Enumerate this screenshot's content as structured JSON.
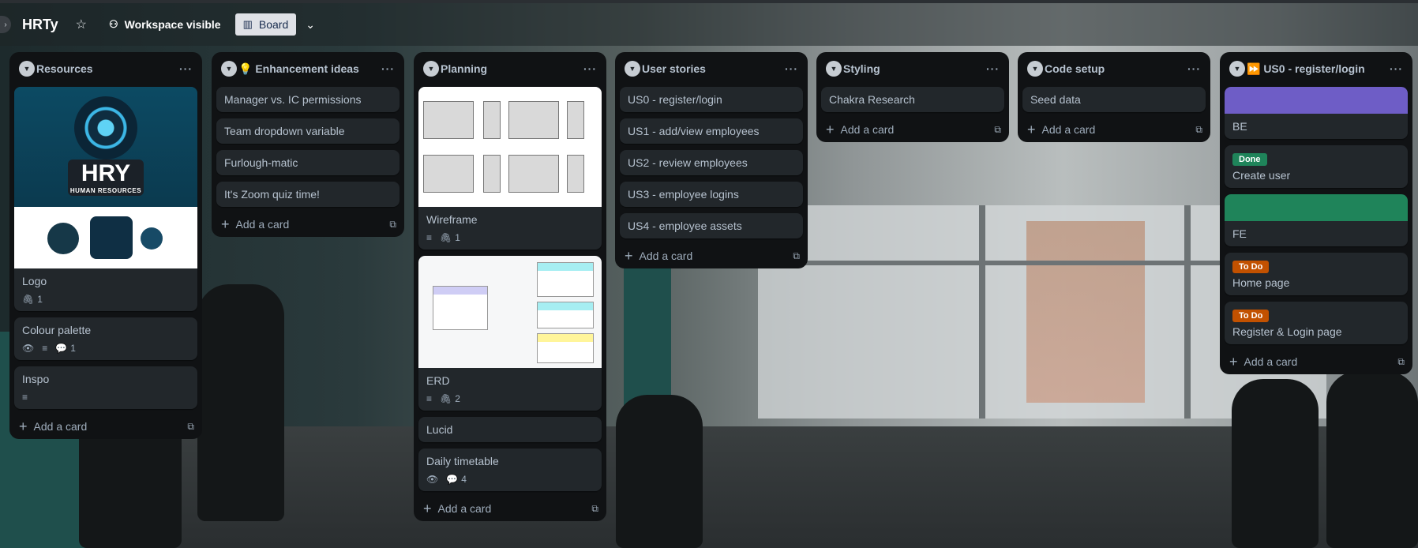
{
  "board": {
    "title": "HRTy",
    "visibility": "Workspace visible",
    "view": "Board"
  },
  "lists": [
    {
      "title": "Resources",
      "cards": [
        {
          "title": "Logo",
          "attachments": "1"
        },
        {
          "title": "Colour palette",
          "comments": "1"
        },
        {
          "title": "Inspo"
        }
      ],
      "add": "Add a card"
    },
    {
      "title": "💡 Enhancement ideas",
      "cards": [
        {
          "title": "Manager vs. IC permissions"
        },
        {
          "title": "Team dropdown variable"
        },
        {
          "title": "Furlough-matic"
        },
        {
          "title": "It's Zoom quiz time!"
        }
      ],
      "add": "Add a card"
    },
    {
      "title": "Planning",
      "cards": [
        {
          "title": "Wireframe",
          "attachments": "1"
        },
        {
          "title": "ERD",
          "attachments": "2"
        },
        {
          "title": "Lucid"
        },
        {
          "title": "Daily timetable",
          "comments": "4"
        }
      ],
      "add": "Add a card"
    },
    {
      "title": "User stories",
      "cards": [
        {
          "title": "US0 - register/login"
        },
        {
          "title": "US1 - add/view employees"
        },
        {
          "title": "US2 - review employees"
        },
        {
          "title": "US3 - employee logins"
        },
        {
          "title": "US4 - employee assets"
        }
      ],
      "add": "Add a card"
    },
    {
      "title": "Styling",
      "cards": [
        {
          "title": "Chakra Research"
        }
      ],
      "add": "Add a card"
    },
    {
      "title": "Code setup",
      "cards": [
        {
          "title": "Seed data"
        }
      ],
      "add": "Add a card"
    },
    {
      "title": "⏩ US0 - register/login",
      "cards": [
        {
          "title": "BE",
          "cover": "#6e5dc6"
        },
        {
          "title": "Create user",
          "label": "Done",
          "label_color": "#1f845a"
        },
        {
          "title": "FE",
          "cover": "#1f845a"
        },
        {
          "title": "Home page",
          "label": "To Do",
          "label_color": "#c25100"
        },
        {
          "title": "Register & Login page",
          "label": "To Do",
          "label_color": "#c25100"
        }
      ],
      "add": "Add a card"
    }
  ],
  "logo": {
    "text": "HRY",
    "subtitle": "HUMAN RESOURCES"
  },
  "colors": {
    "list_bg": "#101214",
    "card_bg": "#22272b",
    "done": "#1f845a",
    "todo": "#c25100",
    "purple_cover": "#6e5dc6"
  }
}
